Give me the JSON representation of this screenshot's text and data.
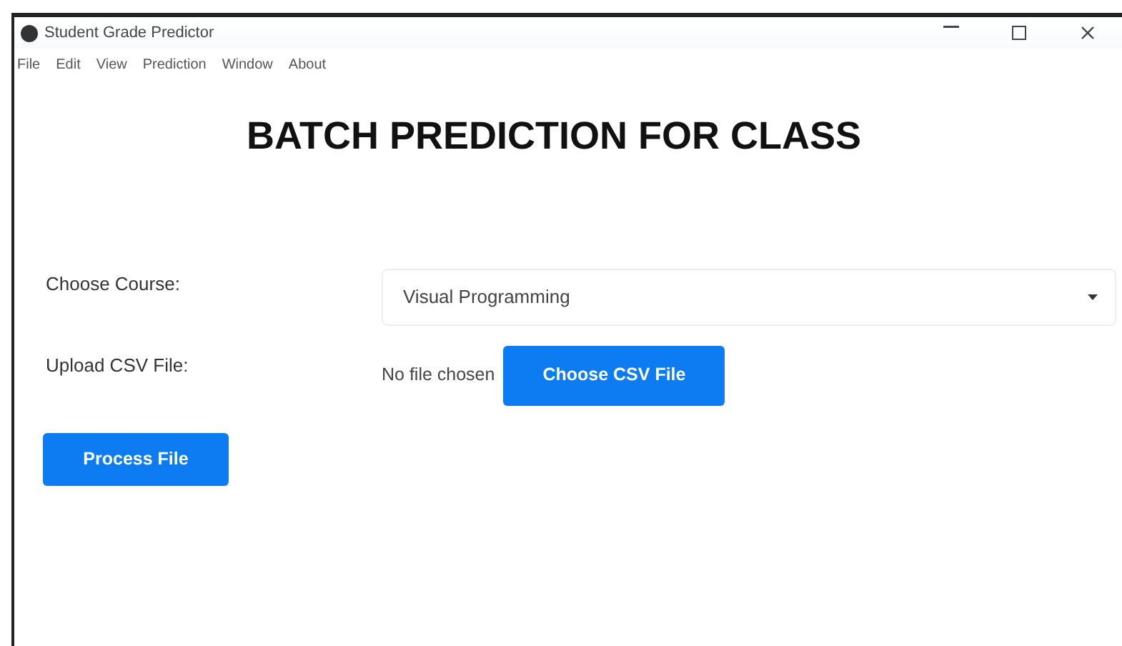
{
  "window": {
    "title": "Student Grade Predictor"
  },
  "menu": [
    {
      "label": "File"
    },
    {
      "label": "Edit"
    },
    {
      "label": "View"
    },
    {
      "label": "Prediction"
    },
    {
      "label": "Window"
    },
    {
      "label": "About"
    }
  ],
  "heading": "BATCH PREDICTION FOR CLASS",
  "course": {
    "label": "Choose Course:",
    "value": "Visual Programming"
  },
  "upload": {
    "label": "Upload CSV File:",
    "status": "No file chosen",
    "button": "Choose CSV File"
  },
  "buttons": [
    "Process File"
  ]
}
